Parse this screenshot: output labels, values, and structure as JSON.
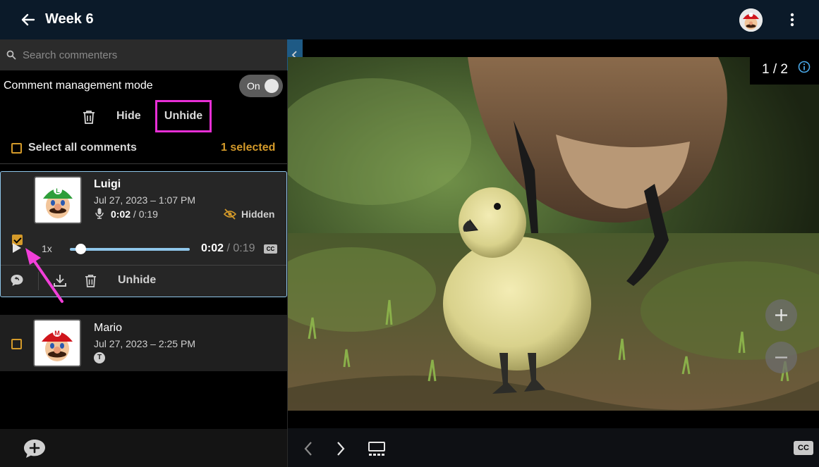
{
  "header": {
    "title": "Week 6",
    "back_icon": "arrow-left-icon",
    "menu_icon": "kebab-icon"
  },
  "search": {
    "placeholder": "Search commenters"
  },
  "comment_management": {
    "label": "Comment management mode",
    "toggle_label": "On",
    "toggle_on": true
  },
  "bulk_actions": {
    "hide_label": "Hide",
    "unhide_label": "Unhide",
    "select_all_label": "Select all comments",
    "selected_count": "1 selected"
  },
  "comments": [
    {
      "name": "Luigi",
      "date": "Jul 27, 2023 – 1:07 PM",
      "audio_current": "0:02",
      "audio_total": " / 0:19",
      "status": "Hidden",
      "checked": true,
      "player": {
        "speed": "1x",
        "current": "0:02",
        "total": " / 0:19",
        "progress": 0.105,
        "cc_label": "CC"
      },
      "actions": {
        "unhide_label": "Unhide"
      }
    },
    {
      "name": "Mario",
      "date": "Jul 27, 2023 – 2:25 PM",
      "type_badge": "T",
      "checked": false
    }
  ],
  "viewer": {
    "page_indicator": "1 / 2",
    "cc_label": "CC"
  },
  "colors": {
    "accent_orange": "#d49a2a",
    "highlight_magenta": "#e82fd6",
    "selected_border": "#8fc6ea",
    "header_bg": "#0b1a29"
  }
}
